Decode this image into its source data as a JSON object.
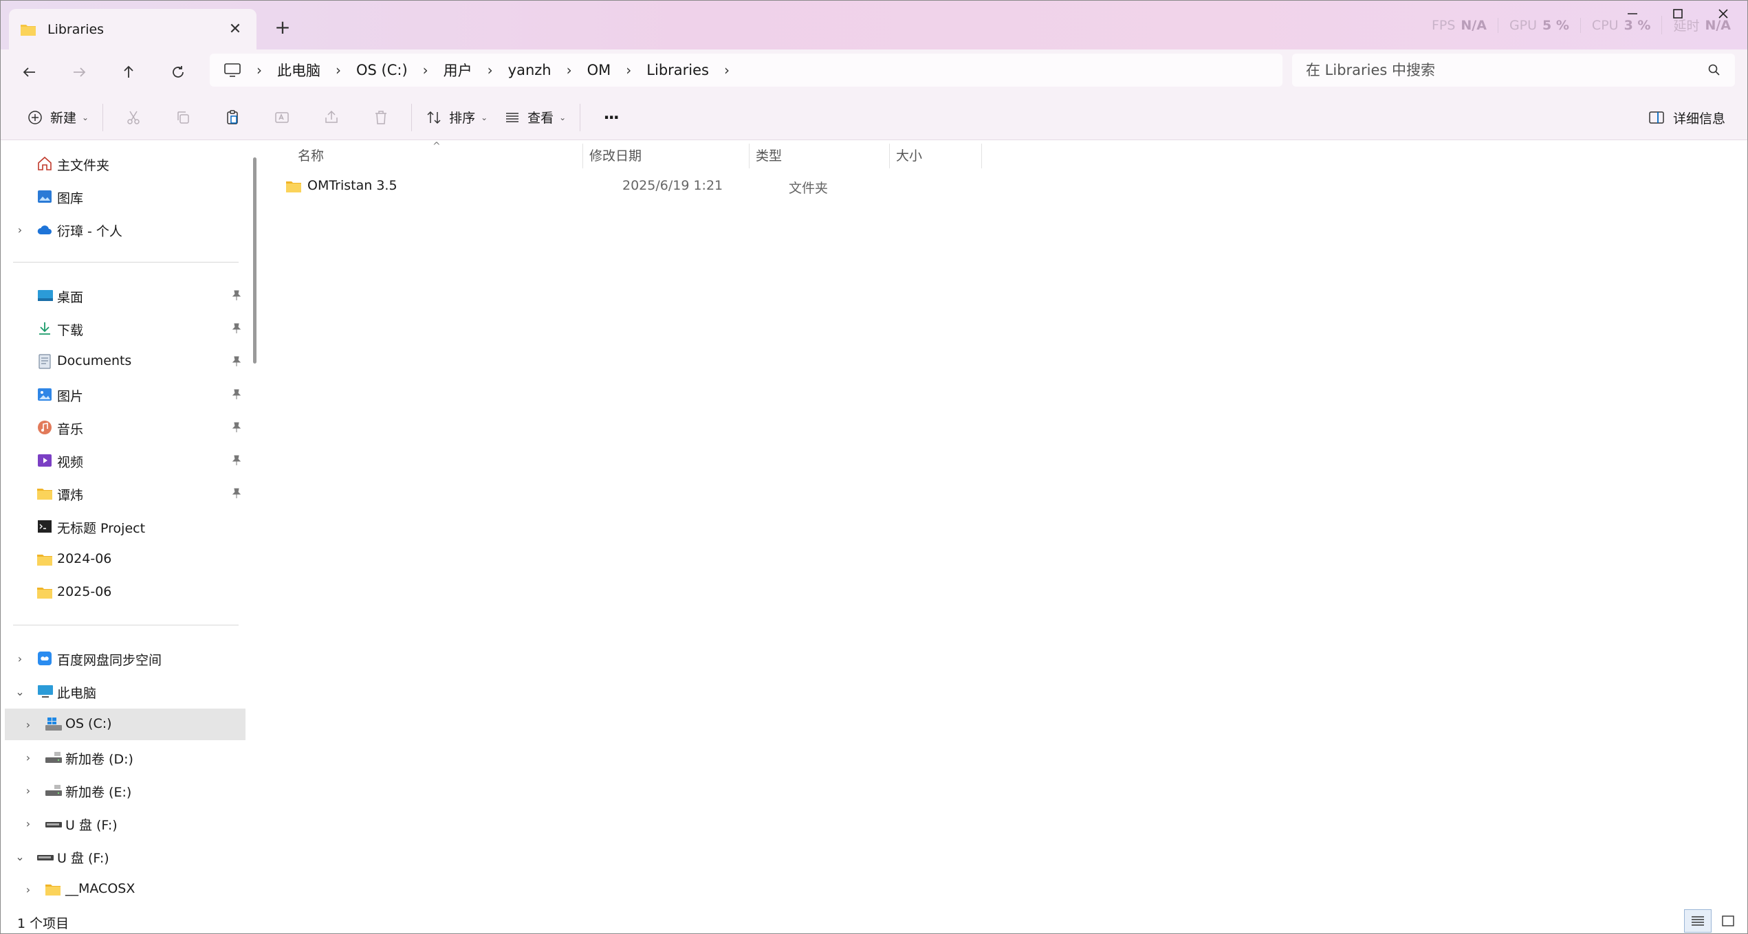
{
  "window": {
    "tab_title": "Libraries",
    "new_tab_glyph": "+",
    "close_glyph": "✕"
  },
  "perf_overlay": [
    {
      "label": "FPS",
      "value": "N/A"
    },
    {
      "label": "GPU",
      "value": "5 %"
    },
    {
      "label": "CPU",
      "value": "3 %"
    },
    {
      "label": "延时",
      "value": "N/A"
    }
  ],
  "breadcrumb": [
    "此电脑",
    "OS (C:)",
    "用户",
    "yanzh",
    "OM",
    "Libraries"
  ],
  "search": {
    "placeholder": "在 Libraries 中搜索"
  },
  "commandbar": {
    "new_label": "新建",
    "sort_label": "排序",
    "view_label": "查看",
    "more_glyph": "···",
    "details_label": "详细信息"
  },
  "sidebar": {
    "top": [
      {
        "label": "主文件夹",
        "icon": "home-icon"
      },
      {
        "label": "图库",
        "icon": "gallery-icon"
      },
      {
        "label": "衍璋 - 个人",
        "icon": "cloud-icon",
        "expandable": true
      }
    ],
    "quick": [
      {
        "label": "桌面",
        "icon": "desktop-icon",
        "pinned": true
      },
      {
        "label": "下载",
        "icon": "download-icon",
        "pinned": true
      },
      {
        "label": "Documents",
        "icon": "documents-icon",
        "pinned": true
      },
      {
        "label": "图片",
        "icon": "pictures-icon",
        "pinned": true
      },
      {
        "label": "音乐",
        "icon": "music-icon",
        "pinned": true
      },
      {
        "label": "视频",
        "icon": "video-icon",
        "pinned": true
      },
      {
        "label": "谭炜",
        "icon": "folder-icon",
        "pinned": true
      },
      {
        "label": "无标题 Project",
        "icon": "project-icon",
        "pinned": false
      },
      {
        "label": "2024-06",
        "icon": "folder-icon",
        "pinned": false
      },
      {
        "label": "2025-06",
        "icon": "folder-icon",
        "pinned": false
      }
    ],
    "tree": [
      {
        "label": "百度网盘同步空间",
        "icon": "baidu-icon",
        "chev": "›",
        "level": 0
      },
      {
        "label": "此电脑",
        "icon": "pc-icon",
        "chev": "⌄",
        "level": 0
      },
      {
        "label": "OS (C:)",
        "icon": "windows-drive-icon",
        "chev": "›",
        "level": 1,
        "selected": true
      },
      {
        "label": "新加卷 (D:)",
        "icon": "drive-icon",
        "chev": "›",
        "level": 1
      },
      {
        "label": "新加卷 (E:)",
        "icon": "drive-icon",
        "chev": "›",
        "level": 1
      },
      {
        "label": "U 盘 (F:)",
        "icon": "usb-drive-icon",
        "chev": "›",
        "level": 1
      },
      {
        "label": "U 盘 (F:)",
        "icon": "usb-drive-icon",
        "chev": "⌄",
        "level": 0
      },
      {
        "label": "__MACOSX",
        "icon": "folder-icon",
        "chev": "›",
        "level": 1
      }
    ]
  },
  "columns": {
    "name": "名称",
    "date": "修改日期",
    "type": "类型",
    "size": "大小"
  },
  "files": [
    {
      "name": "OMTristan 3.5",
      "date": "2025/6/19 1:21",
      "type": "文件夹",
      "size": ""
    }
  ],
  "status": {
    "item_count": "1 个项目"
  },
  "colors": {
    "accent": "#0067c0",
    "folder": "#f5c542",
    "selected_row": "#e5e5e5"
  }
}
